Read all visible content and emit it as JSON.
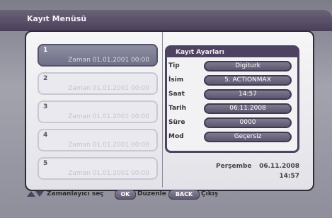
{
  "header": {
    "title": "Kayıt Menüsü"
  },
  "timers": [
    {
      "number": "1",
      "zaman": "Zaman  01.01.2001  00:00",
      "active": true
    },
    {
      "number": "2",
      "zaman": "Zaman  01.01.2001  00:00",
      "active": false
    },
    {
      "number": "3",
      "zaman": "Zaman  01.01.2001  00:00",
      "active": false
    },
    {
      "number": "4",
      "zaman": "Zaman  01.01.2001  00:00",
      "active": false
    },
    {
      "number": "5",
      "zaman": "Zaman  01.01.2001  00:00",
      "active": false
    }
  ],
  "settings": {
    "title": "Kayıt Ayarları",
    "rows": [
      {
        "label": "Tip",
        "value": "Digiturk"
      },
      {
        "label": "İsim",
        "value": "5. ACTIONMAX"
      },
      {
        "label": "Saat",
        "value": "14:57"
      },
      {
        "label": "Tarih",
        "value": "06.11.2008"
      },
      {
        "label": "Süre",
        "value": "0000"
      },
      {
        "label": "Mod",
        "value": "Geçersiz"
      }
    ]
  },
  "datetime": {
    "day": "Perşembe",
    "date": "06.11.2008",
    "time": "14:57"
  },
  "footer": {
    "select_text": "Zamanlayıcı seç",
    "ok_key": "OK",
    "edit_text": "Düzenle",
    "back_key": "BACK",
    "exit_text": "Çıkış"
  }
}
